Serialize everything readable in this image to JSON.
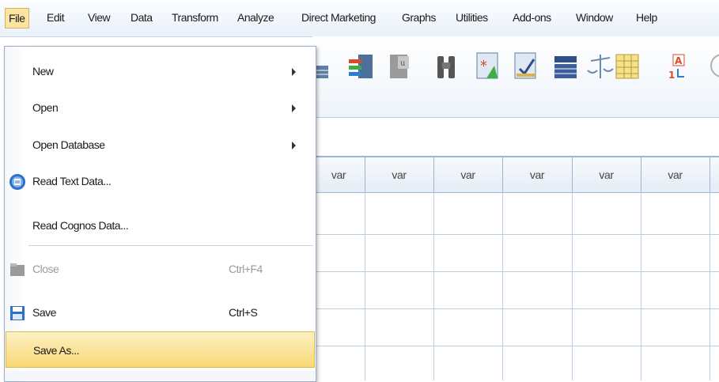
{
  "menubar": {
    "items": [
      "File",
      "Edit",
      "View",
      "Data",
      "Transform",
      "Analyze",
      "Direct Marketing",
      "Graphs",
      "Utilities",
      "Add-ons",
      "Window",
      "Help"
    ]
  },
  "toolbar": {
    "icons": [
      "insert-cases-icon",
      "insert-variable-icon",
      "split-file-icon",
      "weight-cases-icon",
      "find-binoculars-icon",
      "select-cases-icon",
      "value-labels-icon",
      "data-table-icon",
      "balance-scale-icon",
      "grid-yellow-icon",
      "sort-az-icon"
    ]
  },
  "grid": {
    "columns": [
      "var",
      "var",
      "var",
      "var",
      "var",
      "var"
    ]
  },
  "file_menu": {
    "items": [
      {
        "label": "New",
        "submenu": true
      },
      {
        "label": "Open",
        "submenu": true
      },
      {
        "label": "Open Database",
        "submenu": true
      },
      {
        "label": "Read Text Data...",
        "icon": "read-text-data-icon"
      },
      {
        "label": "Read Cognos Data..."
      },
      {
        "label": "Close",
        "shortcut": "Ctrl+F4",
        "disabled": true,
        "icon": "close-folder-icon"
      },
      {
        "label": "Save",
        "shortcut": "Ctrl+S",
        "icon": "save-floppy-icon"
      },
      {
        "label": "Save As...",
        "highlighted": true
      }
    ]
  },
  "colors": {
    "highlight": "#f9d874",
    "menu_active": "#fbe3a2",
    "grid_line": "#b7cde3"
  }
}
